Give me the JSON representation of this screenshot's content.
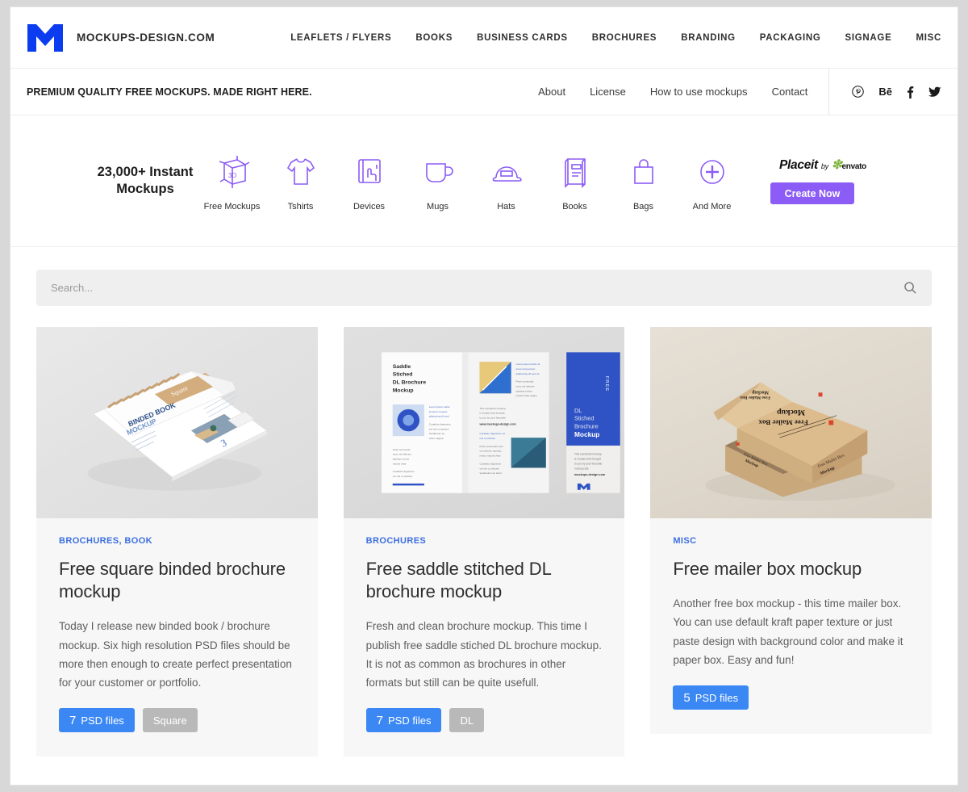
{
  "header": {
    "brand_name": "MOCKUPS-DESIGN.COM",
    "logo_icon": "m-logo-icon",
    "nav": [
      {
        "label": "LEAFLETS / FLYERS"
      },
      {
        "label": "BOOKS"
      },
      {
        "label": "BUSINESS CARDS"
      },
      {
        "label": "BROCHURES"
      },
      {
        "label": "BRANDING"
      },
      {
        "label": "PACKAGING"
      },
      {
        "label": "SIGNAGE"
      },
      {
        "label": "MISC"
      }
    ]
  },
  "subbar": {
    "tagline": "PREMIUM QUALITY FREE MOCKUPS. MADE RIGHT HERE.",
    "links": [
      {
        "label": "About"
      },
      {
        "label": "License"
      },
      {
        "label": "How to use mockups"
      },
      {
        "label": "Contact"
      }
    ],
    "social": [
      {
        "icon": "pinterest-icon",
        "glyph": "Ⓟ"
      },
      {
        "icon": "behance-icon",
        "glyph": "Bē"
      },
      {
        "icon": "facebook-icon",
        "glyph": "f"
      },
      {
        "icon": "twitter-icon",
        "glyph": "🐦"
      }
    ]
  },
  "promo": {
    "headline": "23,000+ Instant Mockups",
    "items": [
      {
        "label": "Free Mockups",
        "icon": "3d-box-icon"
      },
      {
        "label": "Tshirts",
        "icon": "tshirt-icon"
      },
      {
        "label": "Devices",
        "icon": "device-tap-icon"
      },
      {
        "label": "Mugs",
        "icon": "mug-icon"
      },
      {
        "label": "Hats",
        "icon": "cap-icon"
      },
      {
        "label": "Books",
        "icon": "book-icon"
      },
      {
        "label": "Bags",
        "icon": "bag-icon"
      },
      {
        "label": "And More",
        "icon": "plus-circle-icon"
      }
    ],
    "logo_place": "Place",
    "logo_it": "it",
    "logo_by": "by",
    "logo_envato": "envato",
    "cta_label": "Create Now",
    "accent_color": "#8b5cf6"
  },
  "search": {
    "placeholder": "Search...",
    "value": "",
    "icon": "search-icon"
  },
  "cards": [
    {
      "categories": "BROCHURES, BOOK",
      "title": "Free square binded brochure mockup",
      "description": "Today I release new binded book / brochure mockup. Six high resolution PSD files should be more then enough to create perfect presentation for your customer or portfolio.",
      "badges": [
        {
          "count": "7",
          "label": "PSD files",
          "style": "blue"
        },
        {
          "count": "",
          "label": "Square",
          "style": "gray"
        }
      ],
      "image_alt": "spiral binded square book mockup",
      "art_labels": {
        "cover": "Square",
        "line1": "BINDED BOOK",
        "line2": "MOCKUP"
      }
    },
    {
      "categories": "BROCHURES",
      "title": "Free saddle stitched DL brochure mockup",
      "description": "Fresh and clean brochure mockup. This time I publish free saddle stiched DL brochure mockup. It is not as common as brochures in other formats but still can be quite usefull.",
      "badges": [
        {
          "count": "7",
          "label": "PSD files",
          "style": "blue"
        },
        {
          "count": "",
          "label": "DL",
          "style": "gray"
        }
      ],
      "image_alt": "saddle stitched DL brochure mockup",
      "art_labels": {
        "spread_title": "Saddle Stiched DL Brochure Mockup",
        "cover_title": "DL Stiched Brochure Mockup",
        "free_tag": "FREE",
        "url": "mockups-design.com"
      }
    },
    {
      "categories": "MISC",
      "title": "Free mailer box mockup",
      "description": "Another free box mockup - this time mailer box. You can use default kraft paper texture or just paste design with background color and make it paper box. Easy and fun!",
      "badges": [
        {
          "count": "5",
          "label": "PSD files",
          "style": "blue"
        }
      ],
      "image_alt": "kraft mailer box mockup",
      "art_labels": {
        "line1": "Free Mailer Box",
        "line2": "Mockup"
      }
    }
  ]
}
